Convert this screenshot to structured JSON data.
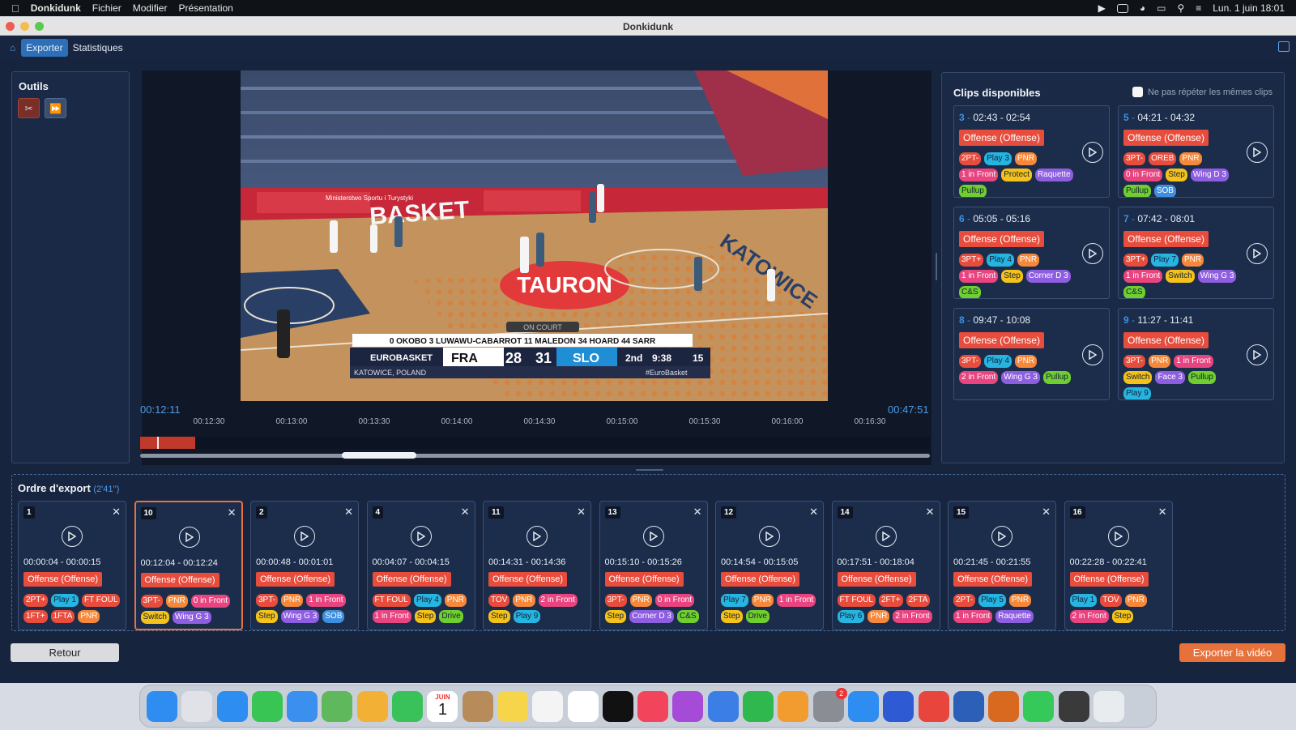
{
  "menubar": {
    "app_name": "Donkidunk",
    "items": [
      "Fichier",
      "Modifier",
      "Présentation"
    ],
    "datetime": "Lun. 1 juin  18:01"
  },
  "window": {
    "title": "Donkidunk"
  },
  "toolbar": {
    "tabs": [
      "Exporter",
      "Statistiques"
    ],
    "active_tab": "Exporter"
  },
  "tools": {
    "title": "Outils",
    "scissors_icon": "scissors-icon",
    "forward_icon": "fast-forward-icon"
  },
  "video": {
    "scoreboard": {
      "on_court": "ON COURT",
      "players": "0 OKOBO   3 LUWAWU-CABARROT   11 MALEDON   34 HOARD   44 SARR",
      "league": "EUROBASKET",
      "team_home": "FRA",
      "score_home": "28",
      "score_away": "31",
      "team_away": "SLO",
      "period": "2nd",
      "clock": "9:38",
      "shot_clock": "15",
      "location": "KATOWICE, POLAND",
      "hashtag": "#EuroBasket"
    },
    "arena_texts": [
      "BASKET",
      "KATOWICE",
      "TAURON",
      "Ministerstwo Sportu i Turystyki"
    ]
  },
  "timeline": {
    "start": "00:12:11",
    "end": "00:47:51",
    "ticks": [
      "00:12:30",
      "00:13:00",
      "00:13:30",
      "00:14:00",
      "00:14:30",
      "00:15:00",
      "00:15:30",
      "00:16:00",
      "00:16:30"
    ]
  },
  "clips": {
    "title": "Clips disponibles",
    "no_repeat_label": "Ne pas répéter les mêmes clips",
    "items": [
      {
        "num": "3",
        "range": "02:43 - 02:54",
        "offense": "Offense (Offense)",
        "tags": [
          "2PT-",
          "Play 3",
          "PNR",
          "1 in Front",
          "Protect",
          "Raquette",
          "Pullup"
        ]
      },
      {
        "num": "5",
        "range": "04:21 - 04:32",
        "offense": "Offense (Offense)",
        "tags": [
          "3PT-",
          "OREB",
          "PNR",
          "0 in Front",
          "Step",
          "Wing D 3",
          "Pullup",
          "SOB"
        ]
      },
      {
        "num": "6",
        "range": "05:05 - 05:16",
        "offense": "Offense (Offense)",
        "tags": [
          "3PT+",
          "Play 4",
          "PNR",
          "1 in Front",
          "Step",
          "Corner D 3",
          "C&S"
        ]
      },
      {
        "num": "7",
        "range": "07:42 - 08:01",
        "offense": "Offense (Offense)",
        "tags": [
          "3PT+",
          "Play 7",
          "PNR",
          "1 in Front",
          "Switch",
          "Wing G 3",
          "C&S"
        ]
      },
      {
        "num": "8",
        "range": "09:47 - 10:08",
        "offense": "Offense (Offense)",
        "tags": [
          "3PT-",
          "Play 4",
          "PNR",
          "2 in Front",
          "Wing G 3",
          "Pullup"
        ]
      },
      {
        "num": "9",
        "range": "11:27 - 11:41",
        "offense": "Offense (Offense)",
        "tags": [
          "3PT-",
          "PNR",
          "1 in Front",
          "Switch",
          "Face 3",
          "Pullup",
          "Play 9"
        ]
      }
    ]
  },
  "export": {
    "title": "Ordre d'export",
    "duration": "(2'41'')",
    "items": [
      {
        "num": "1",
        "range": "00:00:04 - 00:00:15",
        "offense": "Offense (Offense)",
        "tags": [
          "2PT+",
          "Play 1",
          "FT FOUL",
          "1FT+",
          "1FTA",
          "PNR"
        ]
      },
      {
        "num": "10",
        "range": "00:12:04 - 00:12:24",
        "offense": "Offense (Offense)",
        "tags": [
          "3PT-",
          "PNR",
          "0 in Front",
          "Switch",
          "Wing G 3"
        ]
      },
      {
        "num": "2",
        "range": "00:00:48 - 00:01:01",
        "offense": "Offense (Offense)",
        "tags": [
          "3PT-",
          "PNR",
          "1 in Front",
          "Step",
          "Wing G 3",
          "SOB"
        ]
      },
      {
        "num": "4",
        "range": "00:04:07 - 00:04:15",
        "offense": "Offense (Offense)",
        "tags": [
          "FT FOUL",
          "Play 4",
          "PNR",
          "1 in Front",
          "Step",
          "Drive"
        ]
      },
      {
        "num": "11",
        "range": "00:14:31 - 00:14:36",
        "offense": "Offense (Offense)",
        "tags": [
          "TOV",
          "PNR",
          "2 in Front",
          "Step",
          "Play 9"
        ]
      },
      {
        "num": "13",
        "range": "00:15:10 - 00:15:26",
        "offense": "Offense (Offense)",
        "tags": [
          "3PT-",
          "PNR",
          "0 in Front",
          "Step",
          "Corner D 3",
          "C&S"
        ]
      },
      {
        "num": "12",
        "range": "00:14:54 - 00:15:05",
        "offense": "Offense (Offense)",
        "tags": [
          "Play 7",
          "PNR",
          "1 in Front",
          "Step",
          "Drive"
        ]
      },
      {
        "num": "14",
        "range": "00:17:51 - 00:18:04",
        "offense": "Offense (Offense)",
        "tags": [
          "FT FOUL",
          "2FT+",
          "2FTA",
          "Play 6",
          "PNR",
          "2 in Front"
        ]
      },
      {
        "num": "15",
        "range": "00:21:45 - 00:21:55",
        "offense": "Offense (Offense)",
        "tags": [
          "2PT-",
          "Play 5",
          "PNR",
          "1 in Front",
          "Raquette"
        ]
      },
      {
        "num": "16",
        "range": "00:22:28 - 00:22:41",
        "offense": "Offense (Offense)",
        "tags": [
          "Play 1",
          "TOV",
          "PNR",
          "2 in Front",
          "Step"
        ]
      }
    ]
  },
  "buttons": {
    "back": "Retour",
    "export_video": "Exporter la vidéo"
  },
  "dock": {
    "calendar_month": "JUIN",
    "calendar_day": "1",
    "notification_badge": "2",
    "apps": [
      {
        "name": "finder-icon",
        "color": "#2f8cf0"
      },
      {
        "name": "launchpad-icon",
        "color": "#e0e2e8"
      },
      {
        "name": "safari-icon",
        "color": "#2d8df0"
      },
      {
        "name": "messages-icon",
        "color": "#38c553"
      },
      {
        "name": "mail-icon",
        "color": "#3b8fef"
      },
      {
        "name": "maps-icon",
        "color": "#5fb85c"
      },
      {
        "name": "photos-icon",
        "color": "#f2b134"
      },
      {
        "name": "facetime-icon",
        "color": "#3ac25a"
      },
      {
        "name": "calendar-icon",
        "color": "#ffffff"
      },
      {
        "name": "contacts-icon",
        "color": "#b88c5a"
      },
      {
        "name": "notes-icon",
        "color": "#f7d54a"
      },
      {
        "name": "freeform-icon",
        "color": "#f4f4f4"
      },
      {
        "name": "reminders-icon",
        "color": "#ffffff"
      },
      {
        "name": "apple-tv-icon",
        "color": "#111111"
      },
      {
        "name": "music-icon",
        "color": "#f2455b"
      },
      {
        "name": "podcasts-icon",
        "color": "#a64bd8"
      },
      {
        "name": "keynote-icon",
        "color": "#3b7fe6"
      },
      {
        "name": "numbers-icon",
        "color": "#2fb84e"
      },
      {
        "name": "pages-icon",
        "color": "#f29b2f"
      },
      {
        "name": "system-settings-icon",
        "color": "#8a8d93"
      },
      {
        "name": "app-store-icon",
        "color": "#2d8df0"
      },
      {
        "name": "fd-icon",
        "color": "#2e5bd3"
      },
      {
        "name": "chrome-icon",
        "color": "#e8453c"
      },
      {
        "name": "word-icon",
        "color": "#2b5fb8"
      },
      {
        "name": "basketball-app-icon",
        "color": "#d9691f"
      },
      {
        "name": "whatsapp-icon",
        "color": "#35c95a"
      },
      {
        "name": "downloads-icon",
        "color": "#3a3a3a"
      },
      {
        "name": "trash-icon",
        "color": "#e9ecef"
      }
    ]
  },
  "colors": {
    "accent": "#2d6fb8",
    "offense": "#e74c3c",
    "export_button": "#e6713a",
    "time_text": "#4d9be6",
    "tag_colors": {
      "2PT+": "#e74c3c",
      "2PT-": "#e74c3c",
      "3PT+": "#e74c3c",
      "3PT-": "#e74c3c",
      "OREB": "#e74c3c",
      "TOV": "#e74c3c",
      "FT FOUL": "#e74c3c",
      "1FT+": "#e74c3c",
      "1FTA": "#e74c3c",
      "2FT+": "#e74c3c",
      "2FTA": "#e74c3c",
      "Play": "#26b5e0",
      "PNR": "#f5883a",
      "in Front": "#e8447f",
      "Protect": "#f4c21a",
      "Step": "#f4c21a",
      "Switch": "#f4c21a",
      "Raquette": "#8e5ee0",
      "Wing": "#8e5ee0",
      "Corner": "#8e5ee0",
      "Face": "#8e5ee0",
      "Pullup": "#6fcf2e",
      "C&S": "#6fcf2e",
      "Drive": "#6fcf2e",
      "SOB": "#3f8fe0"
    }
  }
}
